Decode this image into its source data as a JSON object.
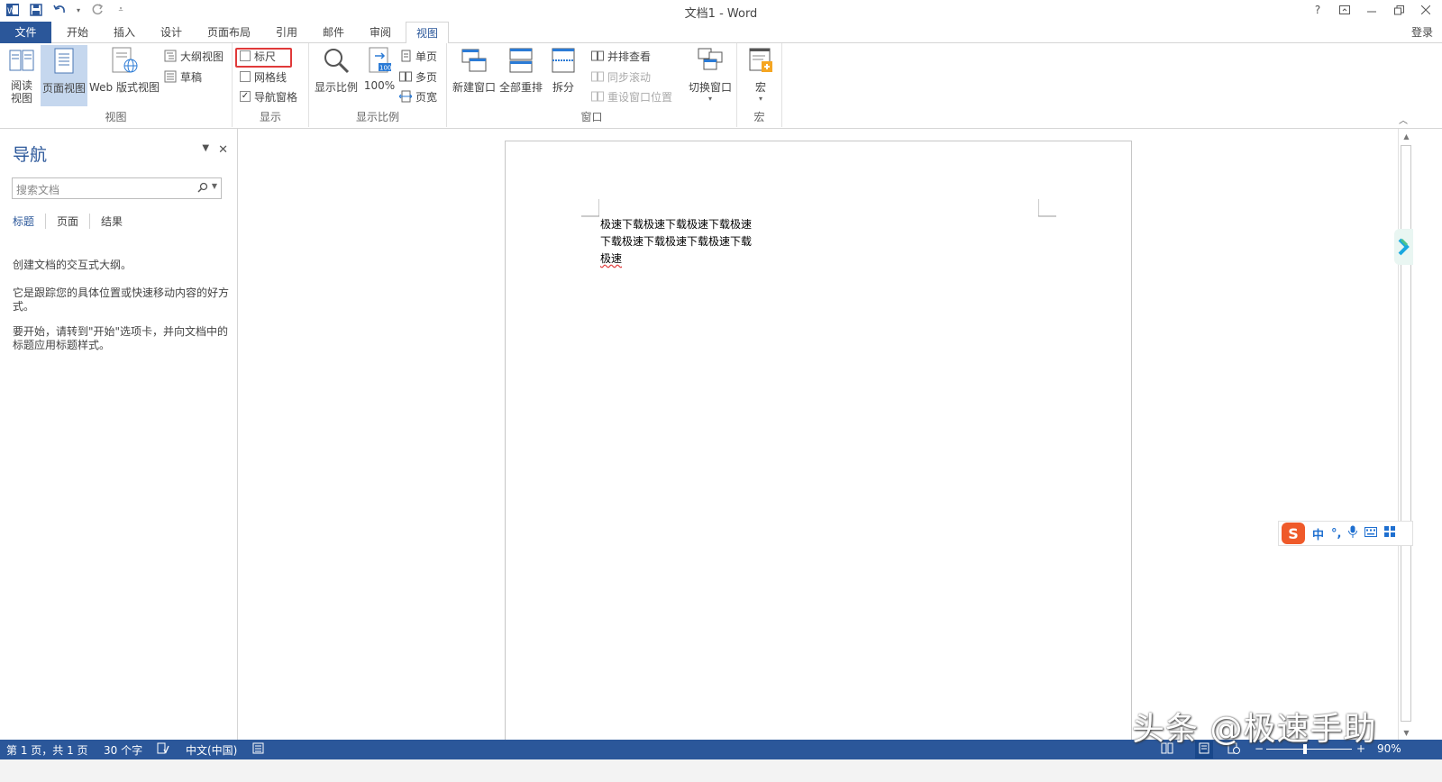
{
  "window": {
    "title": "文档1 - Word",
    "help": "?",
    "login": "登录"
  },
  "tabs": [
    {
      "label": "文件"
    },
    {
      "label": "开始"
    },
    {
      "label": "插入"
    },
    {
      "label": "设计"
    },
    {
      "label": "页面布局"
    },
    {
      "label": "引用"
    },
    {
      "label": "邮件"
    },
    {
      "label": "审阅"
    },
    {
      "label": "视图"
    }
  ],
  "ribbon": {
    "views": {
      "label": "视图",
      "read_line1": "阅读",
      "read_line2": "视图",
      "print_layout": "页面视图",
      "web_layout": "Web 版式视图",
      "outline": "大纲视图",
      "draft": "草稿"
    },
    "show": {
      "label": "显示",
      "ruler": "标尺",
      "gridlines": "网格线",
      "nav_pane": "导航窗格",
      "nav_pane_checked": "✓"
    },
    "zoom": {
      "label": "显示比例",
      "zoom": "显示比例",
      "hundred": "100%",
      "one_page": "单页",
      "multi_page": "多页",
      "page_width": "页宽"
    },
    "window": {
      "label": "窗口",
      "new_window": "新建窗口",
      "arrange_all": "全部重排",
      "split": "拆分",
      "side_by_side": "并排查看",
      "sync_scroll": "同步滚动",
      "reset_pos": "重设窗口位置",
      "switch": "切换窗口"
    },
    "macros": {
      "label": "宏",
      "macros": "宏"
    }
  },
  "nav": {
    "title": "导航",
    "search_placeholder": "搜索文档",
    "tabs": [
      "标题",
      "页面",
      "结果"
    ],
    "p1": "创建文档的交互式大纲。",
    "p2": "它是跟踪您的具体位置或快速移动内容的好方式。",
    "p3": "要开始，请转到\"开始\"选项卡，并向文档中的标题应用标题样式。"
  },
  "document": {
    "line1": "极速下载极速下载极速下载极速",
    "line2": "下载极速下载极速下载极速下载",
    "line3": "极速"
  },
  "ime": {
    "logo": "S",
    "mode": "中",
    "punct": "°,"
  },
  "status": {
    "page": "第 1 页，共 1 页",
    "words": "30 个字",
    "language": "中文(中国)",
    "zoom": "90%"
  },
  "watermark": "头条 @极速手助",
  "colors": {
    "accent": "#2b579a",
    "highlight": "#e03a3a",
    "selected_bg": "#c5d7ee"
  }
}
